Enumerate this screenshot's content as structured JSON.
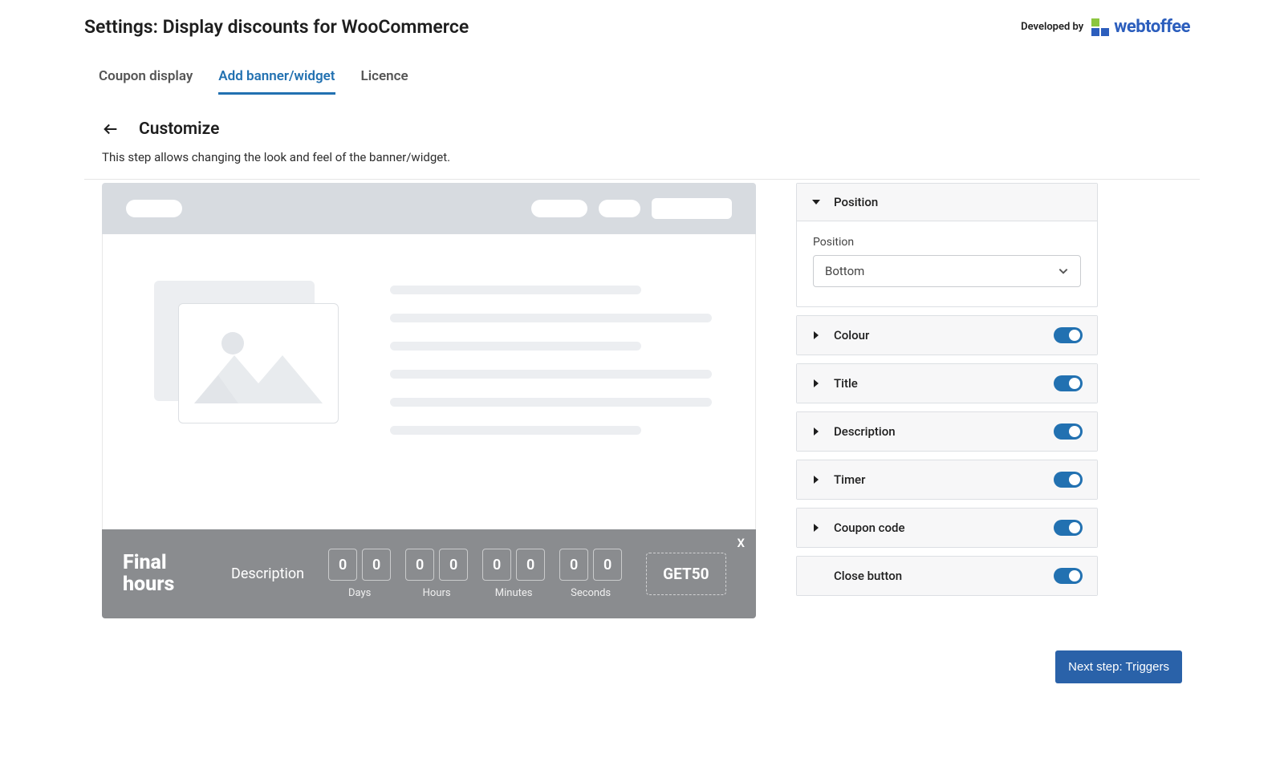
{
  "header": {
    "title": "Settings: Display discounts for WooCommerce",
    "developedBy": "Developed by",
    "brand": "webtoffee"
  },
  "tabs": [
    "Coupon display",
    "Add banner/widget",
    "Licence"
  ],
  "step": {
    "title": "Customize",
    "desc": "This step allows changing the look and feel of the banner/widget."
  },
  "banner": {
    "title": "Final hours",
    "desc": "Description",
    "timer": [
      {
        "v": [
          "0",
          "0"
        ],
        "label": "Days"
      },
      {
        "v": [
          "0",
          "0"
        ],
        "label": "Hours"
      },
      {
        "v": [
          "0",
          "0"
        ],
        "label": "Minutes"
      },
      {
        "v": [
          "0",
          "0"
        ],
        "label": "Seconds"
      }
    ],
    "coupon": "GET50",
    "close": "X"
  },
  "panels": {
    "position": {
      "label": "Position",
      "fieldLabel": "Position",
      "value": "Bottom"
    },
    "colour": "Colour",
    "title": "Title",
    "description": "Description",
    "timer": "Timer",
    "coupon": "Coupon code",
    "close": "Close button"
  },
  "nextBtn": "Next step: Triggers"
}
